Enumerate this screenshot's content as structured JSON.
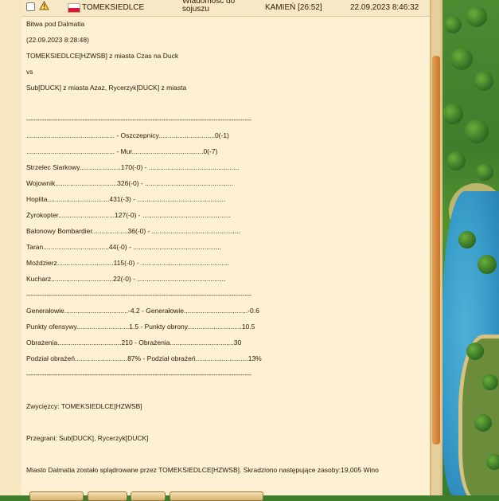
{
  "message": {
    "sender": "TOMEKSIEDLCE",
    "subject": "Wiadomość do sojuszu",
    "city": "KAMIEŃ [26:52]",
    "date": "22.09.2023 8:46:32"
  },
  "report": {
    "lines": [
      "Bitwa pod Dalmatia",
      "(22.09.2023 8:28:48)",
      "TOMEKSIEDLCE[HZWSB] z miasta Czas na Duck",
      "vs",
      "Sub[DUCK] z miasta Azaz, Rycerzyk[DUCK] z miasta",
      "",
      "----------------------------------------------------------------------------------------------------",
      "............................................... - Oszczepnicy..............................0(-1)",
      "............................................... - Mur......................................0(-7)",
      "Strzelec Siarkowy......................170(-0) - ................................................",
      "Wojownik.................................326(-0) - ...............................................",
      "Hoplita.................................431(-3) - ...............................................",
      "Żyrokopter..............................127(-0) - ...............................................",
      "Balonowy Bombardier...................36(-0) - ...............................................",
      "Taran...................................44(-0) - ...............................................",
      "Moździerz..............................115(-0) - ...............................................",
      "Kucharz.................................22(-0) - ...............................................",
      "----------------------------------------------------------------------------------------------------",
      "Generałowie..................................-4.2 - Generałowie..................................-0.6",
      "Punkty ofensywy............................1.5 - Punkty obrony.............................10.5",
      "Obrażenia..................................210 - Obrażenia..................................30",
      "Podział obrażeń............................87% - Podział obrażeń............................13%",
      "----------------------------------------------------------------------------------------------------",
      "",
      "Zwycięzcy: TOMEKSIEDLCE[HZWSB]",
      "",
      "Przegrani: Sub[DUCK], Rycerzyk[DUCK]",
      "",
      "Miasto Dalmatia zostało splądrowane przez TOMEKSIEDLCE[HZWSB]. Skradziono następujące zasoby:19,005 Wino"
    ]
  },
  "icons": {
    "warning": "warning-icon",
    "flag": "flag-poland-icon"
  },
  "colors": {
    "panel": "#fdf0d3",
    "scrollbar": "#d98a3c"
  }
}
